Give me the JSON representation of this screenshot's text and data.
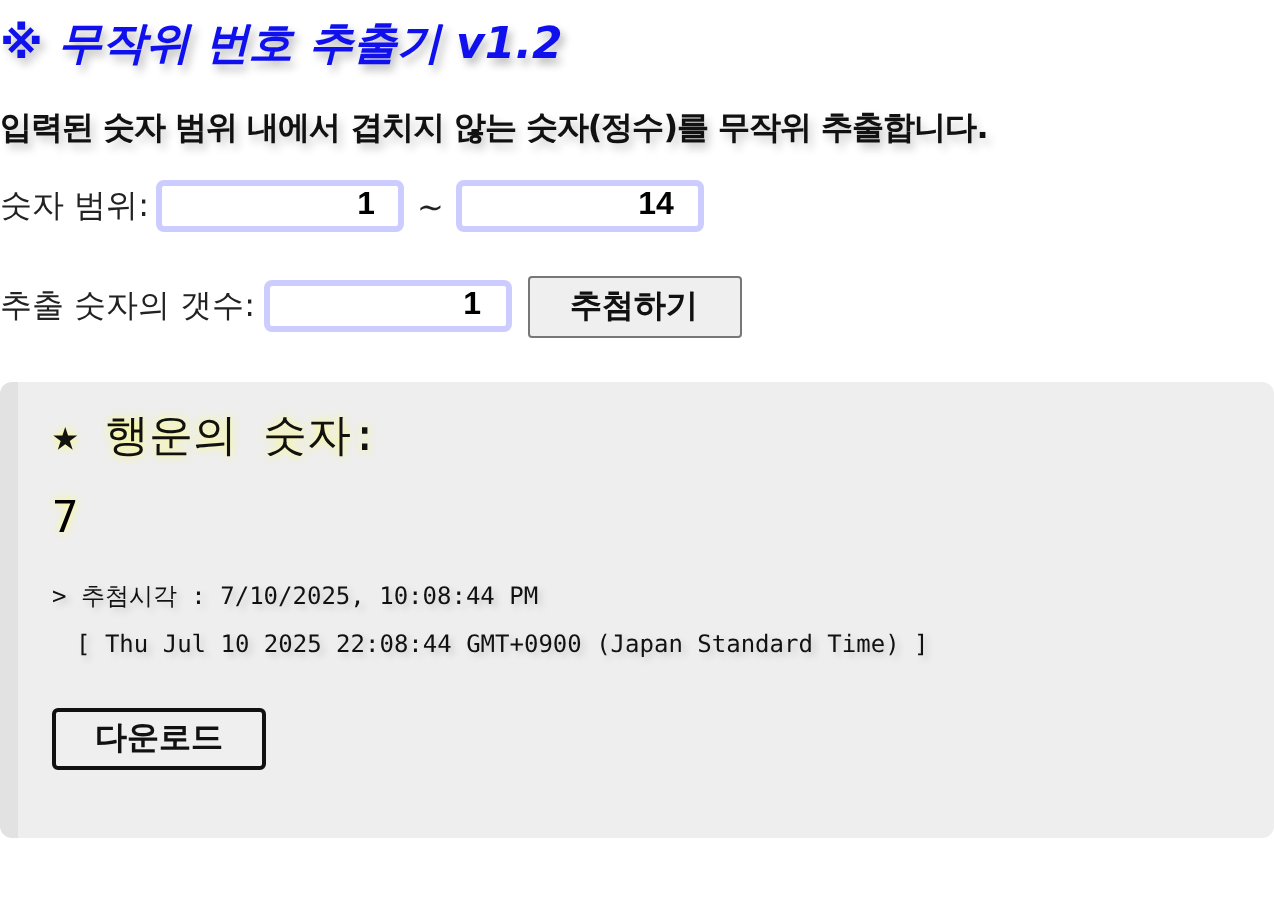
{
  "title": "※ 무작위 번호 추출기 v1.2",
  "description": "입력된 숫자 범위 내에서 겹치지 않는 숫자(정수)를 무작위 추출합니다.",
  "range": {
    "label": "숫자 범위:",
    "from": "1",
    "separator": "~",
    "to": "14"
  },
  "count": {
    "label": "추출 숫자의 갯수:",
    "value": "1"
  },
  "draw_button": "추첨하기",
  "result": {
    "heading": "★ 행운의 숫자:",
    "number": "7",
    "draw_time": "> 추첨시각 : 7/10/2025, 10:08:44 PM",
    "full_time": "[ Thu Jul 10 2025 22:08:44 GMT+0900 (Japan Standard Time) ]",
    "download_button": "다운로드"
  }
}
